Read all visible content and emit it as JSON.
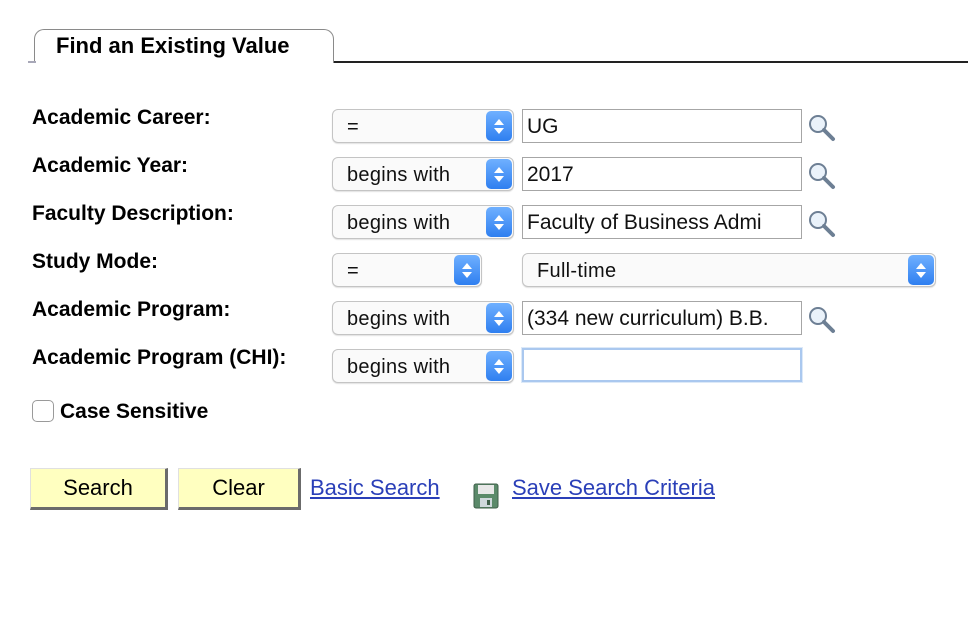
{
  "tab": {
    "title": "Find an Existing Value"
  },
  "fields": [
    {
      "label": "Academic Career:",
      "operator": "=",
      "value": "UG"
    },
    {
      "label": "Academic Year:",
      "operator": "begins with",
      "value": "2017"
    },
    {
      "label": "Faculty Description:",
      "operator": "begins with",
      "value": "Faculty of Business Admi"
    },
    {
      "label": "Study Mode:",
      "operator": "=",
      "value": "Full-time"
    },
    {
      "label": "Academic Program:",
      "operator": "begins with",
      "value": "(334 new curriculum) B.B."
    },
    {
      "label": "Academic Program (CHI):",
      "operator": "begins with",
      "value": ""
    }
  ],
  "case_sensitive": {
    "label": "Case Sensitive",
    "checked": false
  },
  "buttons": {
    "search": "Search",
    "clear": "Clear"
  },
  "links": {
    "basic_search": "Basic Search",
    "save_search": "Save Search Criteria"
  },
  "icons": {
    "lookup": "magnifier-lookup-icon",
    "save": "floppy-disk-icon"
  },
  "colors": {
    "accent_blue": "#2f7ff0",
    "button_bg": "#ffffc0",
    "link": "#2a3fb8"
  }
}
